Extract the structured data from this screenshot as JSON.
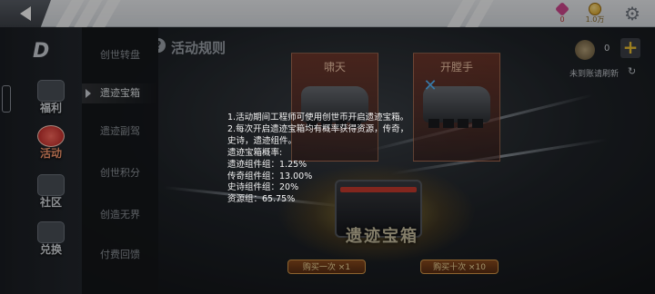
{
  "top_bar": {
    "crystal_amount": "0",
    "coin_amount": "1.0万",
    "settings_icon": "gear-icon",
    "back_icon": "back-arrow-icon"
  },
  "rail": {
    "logo": "D",
    "items": [
      {
        "label": "福利",
        "icon": "gift-icon"
      },
      {
        "label": "活动",
        "icon": "activity-icon"
      },
      {
        "label": "社区",
        "icon": "home-icon"
      },
      {
        "label": "兑换",
        "icon": "exchange-icon"
      }
    ]
  },
  "submenu": {
    "items": [
      "创世转盘",
      "遗迹宝箱",
      "遗迹副驾",
      "创世积分",
      "创造无界",
      "付费回馈"
    ],
    "active_index": 1
  },
  "main": {
    "rules_title": "活动规则",
    "help_icon": "?",
    "banner_left": "啸天",
    "banner_right": "开膛手",
    "chest_title": "遗迹宝箱",
    "draw_once": "购买一次 ×1",
    "draw_ten": "购买十次 ×10",
    "token_count": "0",
    "token_add": "+",
    "refresh_label": "未到账请刷新",
    "refresh_icon": "refresh-icon"
  },
  "rules_text": [
    "1.活动期间工程师可使用创世币开启遗迹宝箱。",
    "2.每次开启遗迹宝箱均有概率获得资源，传奇，",
    "史诗，遗迹组件。",
    "遗迹宝箱概率:",
    "遗迹组件组：1.25%",
    "传奇组件组：13.00%",
    "史诗组件组：20%",
    "资源组：65.75%"
  ],
  "colors": {
    "accent_gold": "#f2c432",
    "activity_red": "#c83b2f",
    "topbar_bg": "#eef0f3"
  }
}
